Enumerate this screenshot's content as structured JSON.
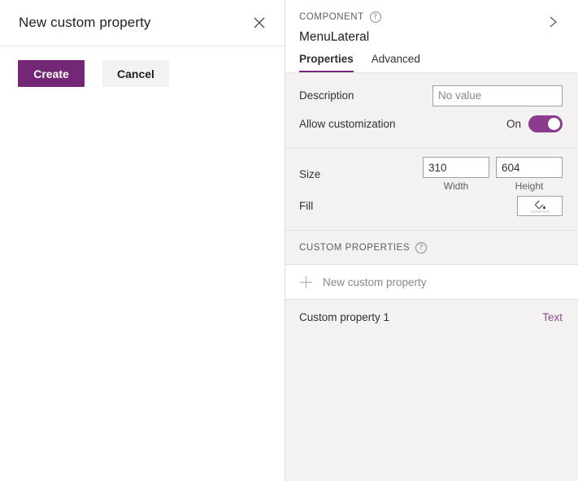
{
  "dialog": {
    "title": "New custom property",
    "close_icon": "close-icon",
    "create_label": "Create",
    "cancel_label": "Cancel"
  },
  "panel": {
    "eyebrow": "COMPONENT",
    "help_glyph": "?",
    "component_name": "MenuLateral",
    "collapse_icon": "chevron-right-icon",
    "tabs": [
      {
        "label": "Properties"
      },
      {
        "label": "Advanced"
      }
    ],
    "properties": {
      "description_label": "Description",
      "description_value": "",
      "description_placeholder": "No value",
      "allow_customization_label": "Allow customization",
      "allow_customization_state": "On",
      "size_label": "Size",
      "width_value": "310",
      "width_sublabel": "Width",
      "height_value": "604",
      "height_sublabel": "Height",
      "fill_label": "Fill",
      "fill_icon": "paint-bucket-icon"
    },
    "custom_properties": {
      "header": "CUSTOM PROPERTIES",
      "help_glyph": "?",
      "new_label": "New custom property",
      "plus_icon": "plus-icon",
      "items": [
        {
          "name": "Custom property 1",
          "type": "Text"
        }
      ]
    }
  },
  "colors": {
    "accent": "#742774",
    "toggle_on": "#8c3c8c",
    "link": "#8a4d8a",
    "panel_bg": "#f3f2f1"
  }
}
